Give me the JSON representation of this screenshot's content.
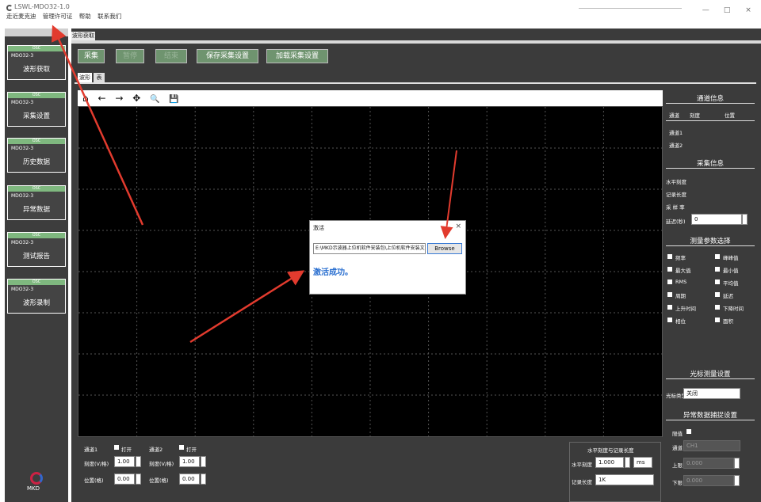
{
  "window": {
    "title": "LSWL-MDO32-1.0",
    "menu": [
      "走近麦克迪",
      "管理许可证",
      "帮助",
      "联系我们"
    ],
    "controls": [
      "—",
      "□",
      "×"
    ]
  },
  "sidebar": {
    "cards": [
      {
        "tag": "OSC",
        "model": "MDO32-3",
        "label": "波形获取"
      },
      {
        "tag": "OSC",
        "model": "MDO32-3",
        "label": "采集设置"
      },
      {
        "tag": "OSC",
        "model": "MDO32-3",
        "label": "历史数据"
      },
      {
        "tag": "OSC",
        "model": "MDO32-3",
        "label": "异常数据"
      },
      {
        "tag": "OSC",
        "model": "MDO32-3",
        "label": "测试报告"
      },
      {
        "tag": "OSC",
        "model": "MDO32-3",
        "label": "波形录制"
      }
    ],
    "logo_text": "MKD"
  },
  "main": {
    "tab": "波形获取",
    "toolbar": {
      "start": "采集",
      "pause": "暂停",
      "stop": "结束",
      "save": "保存采集设置",
      "load": "加载采集设置"
    },
    "subtabs": [
      "波形",
      "表"
    ],
    "plot_tools": [
      "home-icon",
      "back-arrow-icon",
      "forward-arrow-icon",
      "pan-icon",
      "zoom-icon",
      "save-icon"
    ],
    "plot_tool_glyphs": [
      "⌂",
      "←",
      "→",
      "✥",
      "🔍",
      "💾"
    ]
  },
  "bottom": {
    "ch1": {
      "title": "通道1",
      "open": "打开",
      "scale_label": "刻度(V/格)",
      "scale": "1.00",
      "pos_label": "位置(格)",
      "pos": "0.00"
    },
    "ch2": {
      "title": "通道2",
      "open": "打开",
      "scale_label": "刻度(V/格)",
      "scale": "1.00",
      "pos_label": "位置(格)",
      "pos": "0.00"
    },
    "horizontal": {
      "title": "水平刻度与记录长度",
      "scale_label": "水平刻度",
      "scale": "1.000",
      "unit": "ms",
      "length_label": "记录长度",
      "length": "1K"
    }
  },
  "right": {
    "channel_info": {
      "title": "通道信息",
      "cols": [
        "通道",
        "刻度",
        "位置"
      ],
      "rows": [
        "通道1",
        "通道2"
      ]
    },
    "acq_info": {
      "title": "采集信息",
      "rows": [
        "水平刻度",
        "记录长度",
        "采 样 率"
      ],
      "delay_label": "延迟(秒)",
      "delay": "0"
    },
    "measure": {
      "title": "测量参数选择",
      "items": [
        "频率",
        "峰峰值",
        "最大值",
        "最小值",
        "RMS",
        "平均值",
        "周期",
        "延迟",
        "上升时间",
        "下降时间",
        "相位",
        "面积"
      ]
    },
    "cursor": {
      "title": "光标测量设置",
      "type_label": "光标类型",
      "type": "关闭"
    },
    "abnormal": {
      "title": "异常数据捕捉设置",
      "limit_label": "限值",
      "channel_label": "通道",
      "channel": "CH1",
      "upper_label": "上限",
      "upper": "0.000",
      "lower_label": "下限",
      "lower": "0.000"
    }
  },
  "dialog": {
    "title": "激活",
    "path": "E:\\MKD示波器上位机软件安装包\\上位机软件安装文",
    "browse": "Browse",
    "message": "激活成功。",
    "close": "×"
  }
}
